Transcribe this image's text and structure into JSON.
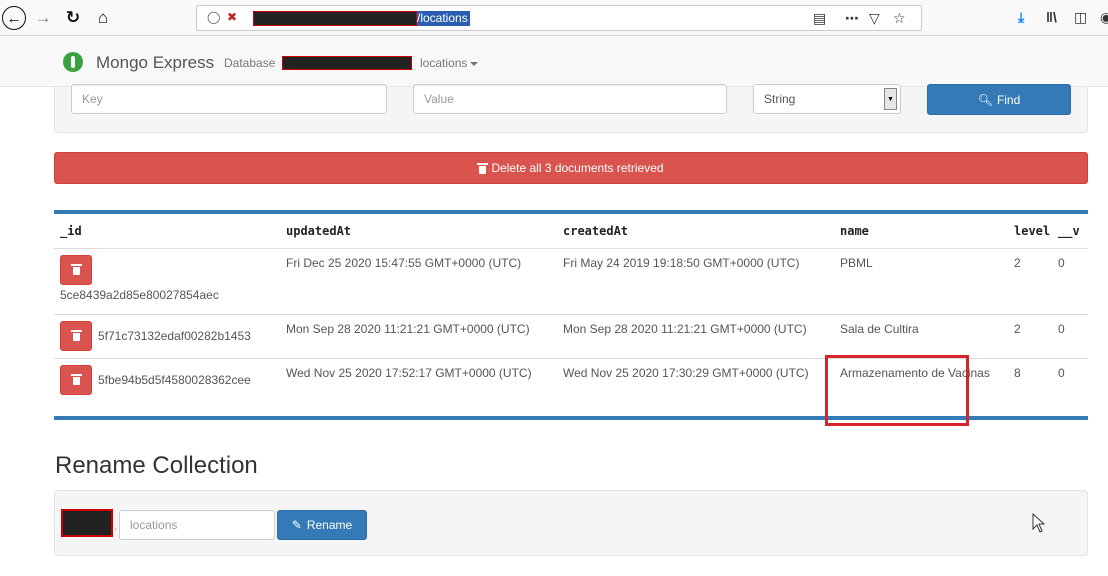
{
  "browser": {
    "url_path": "/locations",
    "icons": [
      "back-icon",
      "forward-icon",
      "reload-icon",
      "home-icon",
      "shield-icon",
      "lock-slash-icon",
      "reader-icon",
      "more-icon",
      "pocket-icon",
      "star-icon",
      "download-icon",
      "library-icon",
      "sidebar-icon",
      "account-icon"
    ]
  },
  "navbar": {
    "brand": "Mongo Express",
    "database_label": "Database",
    "collection": "locations"
  },
  "search": {
    "key_placeholder": "Key",
    "value_placeholder": "Value",
    "type_value": "String",
    "find_label": "Find"
  },
  "delete_all": {
    "label": "Delete all 3 documents retrieved"
  },
  "table": {
    "columns": [
      "_id",
      "updatedAt",
      "createdAt",
      "name",
      "level",
      "__v"
    ],
    "rows": [
      {
        "id": "5ce8439a2d85e80027854aec",
        "updatedAt": "Fri Dec 25 2020 15:47:55 GMT+0000 (UTC)",
        "createdAt": "Fri May 24 2019 19:18:50 GMT+0000 (UTC)",
        "name": "PBML",
        "level": "2",
        "v": "0"
      },
      {
        "id": "5f71c73132edaf00282b1453",
        "updatedAt": "Mon Sep 28 2020 11:21:21 GMT+0000 (UTC)",
        "createdAt": "Mon Sep 28 2020 11:21:21 GMT+0000 (UTC)",
        "name": "Sala de Cultira",
        "level": "2",
        "v": "0"
      },
      {
        "id": "5fbe94b5d5f4580028362cee",
        "updatedAt": "Wed Nov 25 2020 17:52:17 GMT+0000 (UTC)",
        "createdAt": "Wed Nov 25 2020 17:30:29 GMT+0000 (UTC)",
        "name": "Armazenamento de Vacinas",
        "level": "8",
        "v": "0"
      }
    ]
  },
  "rename": {
    "title": "Rename Collection",
    "placeholder": "locations",
    "button_label": "Rename"
  },
  "colors": {
    "primary": "#337ab7",
    "danger": "#d9534f",
    "highlight": "#d5252f"
  }
}
